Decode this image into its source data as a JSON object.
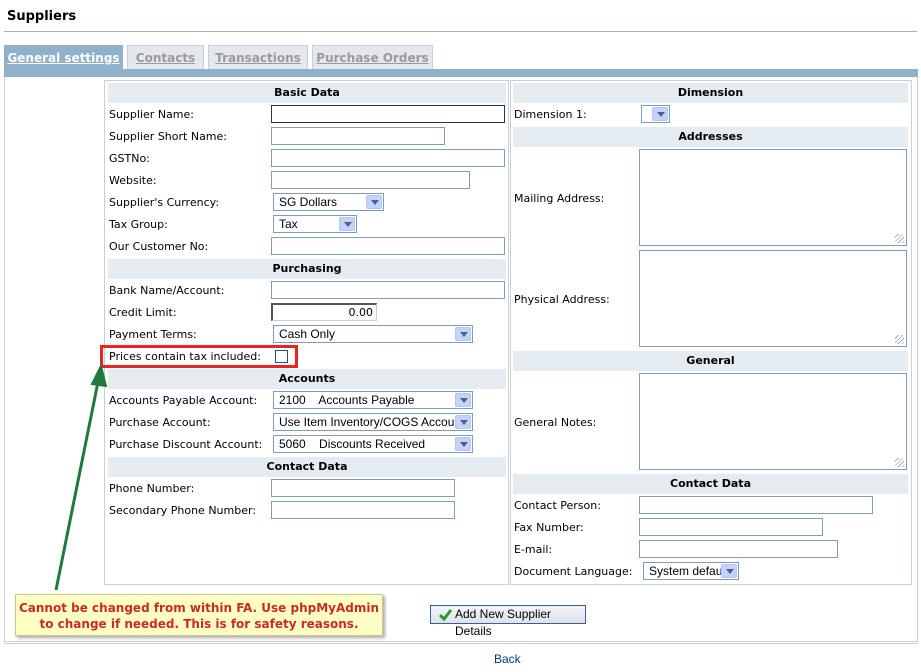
{
  "page": {
    "title": "Suppliers",
    "back_label": "Back"
  },
  "tabs": [
    "General settings",
    "Contacts",
    "Transactions",
    "Purchase Orders"
  ],
  "left": {
    "basic_header": "Basic Data",
    "supplier_name": "Supplier Name:",
    "short_name": "Supplier Short Name:",
    "gst": "GSTNo:",
    "website": "Website:",
    "currency_label": "Supplier's Currency:",
    "currency_value": "SG Dollars",
    "tax_group_label": "Tax Group:",
    "tax_group_value": "Tax",
    "customer_no": "Our Customer No:",
    "purchasing_header": "Purchasing",
    "bank": "Bank Name/Account:",
    "credit_label": "Credit Limit:",
    "credit_value": "0.00",
    "terms_label": "Payment Terms:",
    "terms_value": "Cash Only",
    "prices_tax": "Prices contain tax included:",
    "accounts_header": "Accounts",
    "ap_label": "Accounts Payable Account:",
    "ap_value": "2100    Accounts Payable",
    "purchase_label": "Purchase Account:",
    "purchase_value": "Use Item Inventory/COGS Account",
    "discount_label": "Purchase Discount Account:",
    "discount_value": "5060    Discounts Received",
    "contact_header": "Contact Data",
    "phone": "Phone Number:",
    "phone2": "Secondary Phone Number:"
  },
  "right": {
    "dimension_header": "Dimension",
    "dimension1": "Dimension 1:",
    "addresses_header": "Addresses",
    "mailing": "Mailing Address:",
    "physical": "Physical Address:",
    "general_header": "General",
    "notes": "General Notes:",
    "contact_header": "Contact Data",
    "contact_person": "Contact Person:",
    "fax": "Fax Number:",
    "email": "E-mail:",
    "doc_lang_label": "Document Language:",
    "doc_lang_value": "System default"
  },
  "annotation": "Cannot be changed from within FA. Use phpMyAdmin to change if needed. This is for safety reasons.",
  "add_button": "Add New Supplier Details"
}
